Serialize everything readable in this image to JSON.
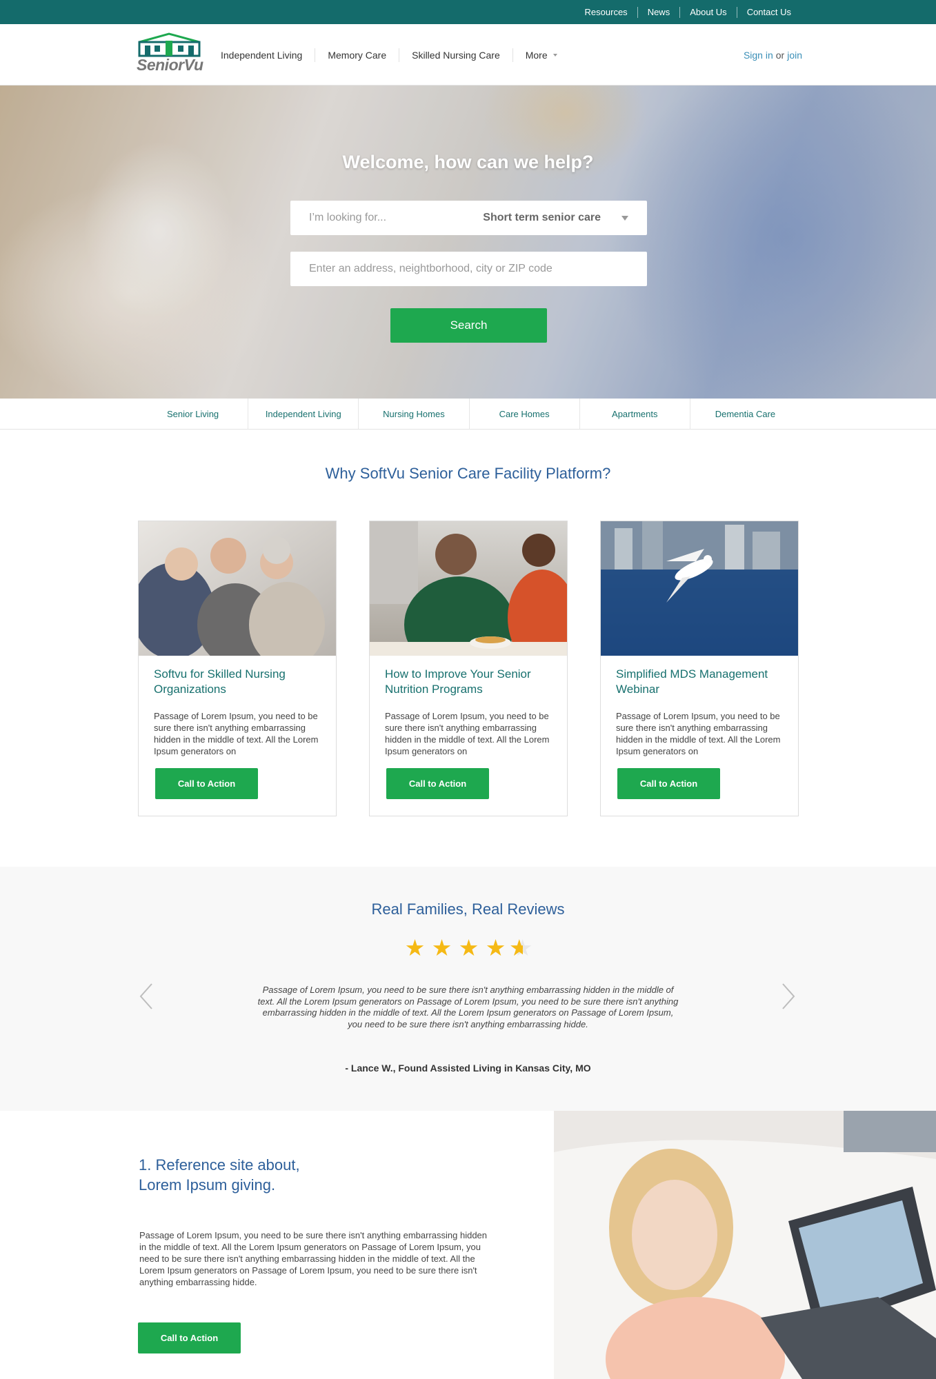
{
  "topbar": {
    "links": [
      "Resources",
      "News",
      "About Us",
      "Contact Us"
    ]
  },
  "header": {
    "logo_text": "SeniorVu",
    "nav": [
      "Independent Living",
      "Memory Care",
      "Skilled Nursing Care",
      "More"
    ],
    "signin": "Sign in",
    "or": "or",
    "join": "join"
  },
  "hero": {
    "title": "Welcome, how can we help?",
    "looking_placeholder": "I’m looking for...",
    "looking_selected": "Short term senior care",
    "address_placeholder": "Enter an address, neightborhood, city or ZIP code",
    "search_label": "Search"
  },
  "categories": [
    "Senior Living",
    "Independent Living",
    "Nursing Homes",
    "Care Homes",
    "Apartments",
    "Dementia Care"
  ],
  "why": {
    "title": "Why SoftVu Senior Care Facility Platform?",
    "cards": [
      {
        "title": "Softvu for Skilled Nursing Organizations",
        "text": "Passage of Lorem Ipsum, you need to be sure there isn't anything embarrassing hidden in the middle of text. All the Lorem Ipsum generators on",
        "cta": "Call to Action"
      },
      {
        "title": "How to Improve Your Senior Nutrition Programs",
        "text": "Passage of Lorem Ipsum, you need to be sure there isn't anything embarrassing hidden in the middle of text. All the Lorem Ipsum generators on",
        "cta": "Call to Action"
      },
      {
        "title": "Simplified MDS Management Webinar",
        "text": "Passage of Lorem Ipsum, you need to be sure there isn't anything embarrassing hidden in the middle of text. All the Lorem Ipsum generators on",
        "cta": "Call to Action"
      }
    ]
  },
  "reviews": {
    "title": "Real Families, Real Reviews",
    "rating": 4.5,
    "text": "Passage of Lorem Ipsum, you need to be sure there isn't anything embarrassing hidden in the middle of text. All the Lorem Ipsum generators on Passage of Lorem Ipsum, you need to be sure there isn't anything embarrassing hidden in the middle of text. All the Lorem Ipsum generators on Passage of Lorem Ipsum, you need to be sure there isn't anything embarrassing hidde.",
    "author": "- Lance W., Found Assisted Living in Kansas City, MO"
  },
  "reference": {
    "title_line1": "1. Reference site about,",
    "title_line2": "Lorem Ipsum giving.",
    "text": "Passage of Lorem Ipsum, you need to be sure there isn't anything embarrassing hidden in the middle of text. All the Lorem Ipsum generators on Passage of Lorem Ipsum, you need to be sure there isn't anything embarrassing hidden in the middle of text. All the Lorem Ipsum generators on Passage of Lorem Ipsum, you need to be sure there isn't anything embarrassing hidde.",
    "cta": "Call to Action"
  },
  "colors": {
    "topbar": "#146b6b",
    "accent_green": "#1ea84f",
    "heading_blue": "#2d5f9a",
    "teal_text": "#17706e",
    "star": "#f5b915"
  }
}
